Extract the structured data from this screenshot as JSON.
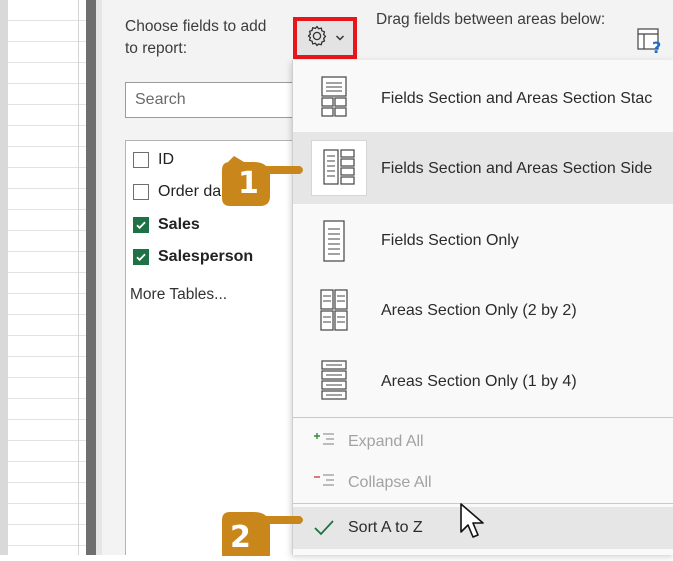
{
  "pane": {
    "choose_fields_label": "Choose fields to add to report:",
    "drag_fields_label": "Drag fields between areas below:",
    "search_placeholder": "Search"
  },
  "fields": [
    {
      "name": "ID",
      "checked": false,
      "bold": false
    },
    {
      "name": "Order da",
      "checked": false,
      "bold": false
    },
    {
      "name": "Sales",
      "checked": true,
      "bold": true
    },
    {
      "name": "Salesperson",
      "checked": true,
      "bold": true
    }
  ],
  "more_tables_link": "More Tables...",
  "menu": {
    "layouts": [
      {
        "label": "Fields Section and Areas Section Stac",
        "icon": "stacked-layout-icon",
        "selected": false
      },
      {
        "label": "Fields Section and Areas Section Side",
        "icon": "side-by-side-layout-icon",
        "selected": true
      },
      {
        "label": "Fields Section Only",
        "icon": "fields-only-layout-icon",
        "selected": false
      },
      {
        "label": "Areas Section Only (2 by 2)",
        "icon": "areas-2x2-layout-icon",
        "selected": false
      },
      {
        "label": "Areas Section Only (1 by 4)",
        "icon": "areas-1x4-layout-icon",
        "selected": false
      }
    ],
    "expand_all": "Expand All",
    "collapse_all": "Collapse All",
    "sort_a_to_z": "Sort A to Z"
  },
  "callouts": {
    "step1": "1",
    "step2": "2"
  },
  "colors": {
    "highlight_border": "#e8151b",
    "checkbox_checked": "#1e7145",
    "callout_orange": "#c9861a"
  }
}
